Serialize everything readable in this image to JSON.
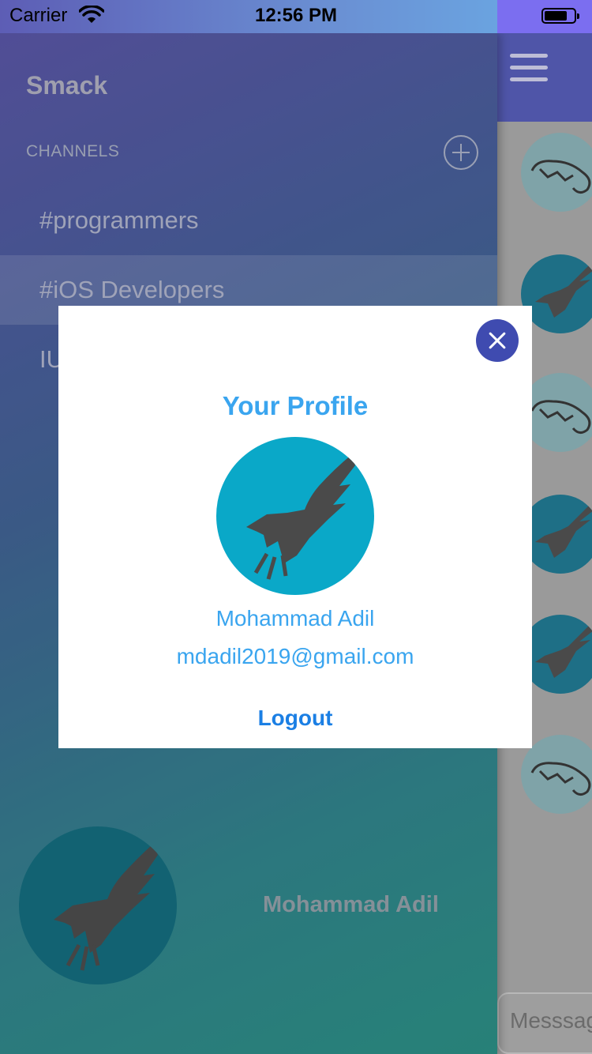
{
  "status_bar": {
    "carrier": "Carrier",
    "time": "12:56 PM"
  },
  "side_menu": {
    "app_title": "Smack",
    "channels_header": "CHANNELS",
    "channels": [
      {
        "label": "#programmers"
      },
      {
        "label": "#iOS Developers",
        "selected": true
      },
      {
        "label": "IU"
      }
    ],
    "user_name": "Mohammad Adil"
  },
  "chat": {
    "message_placeholder": "Messsage"
  },
  "profile_modal": {
    "title": "Your Profile",
    "name": "Mohammad Adil",
    "email": "mdadil2019@gmail.com",
    "logout_label": "Logout"
  },
  "colors": {
    "accent": "#3aa5ef",
    "logout": "#1b7fe4",
    "close_button": "#3f4bb0",
    "avatar_bg": "#0aa8c8"
  }
}
